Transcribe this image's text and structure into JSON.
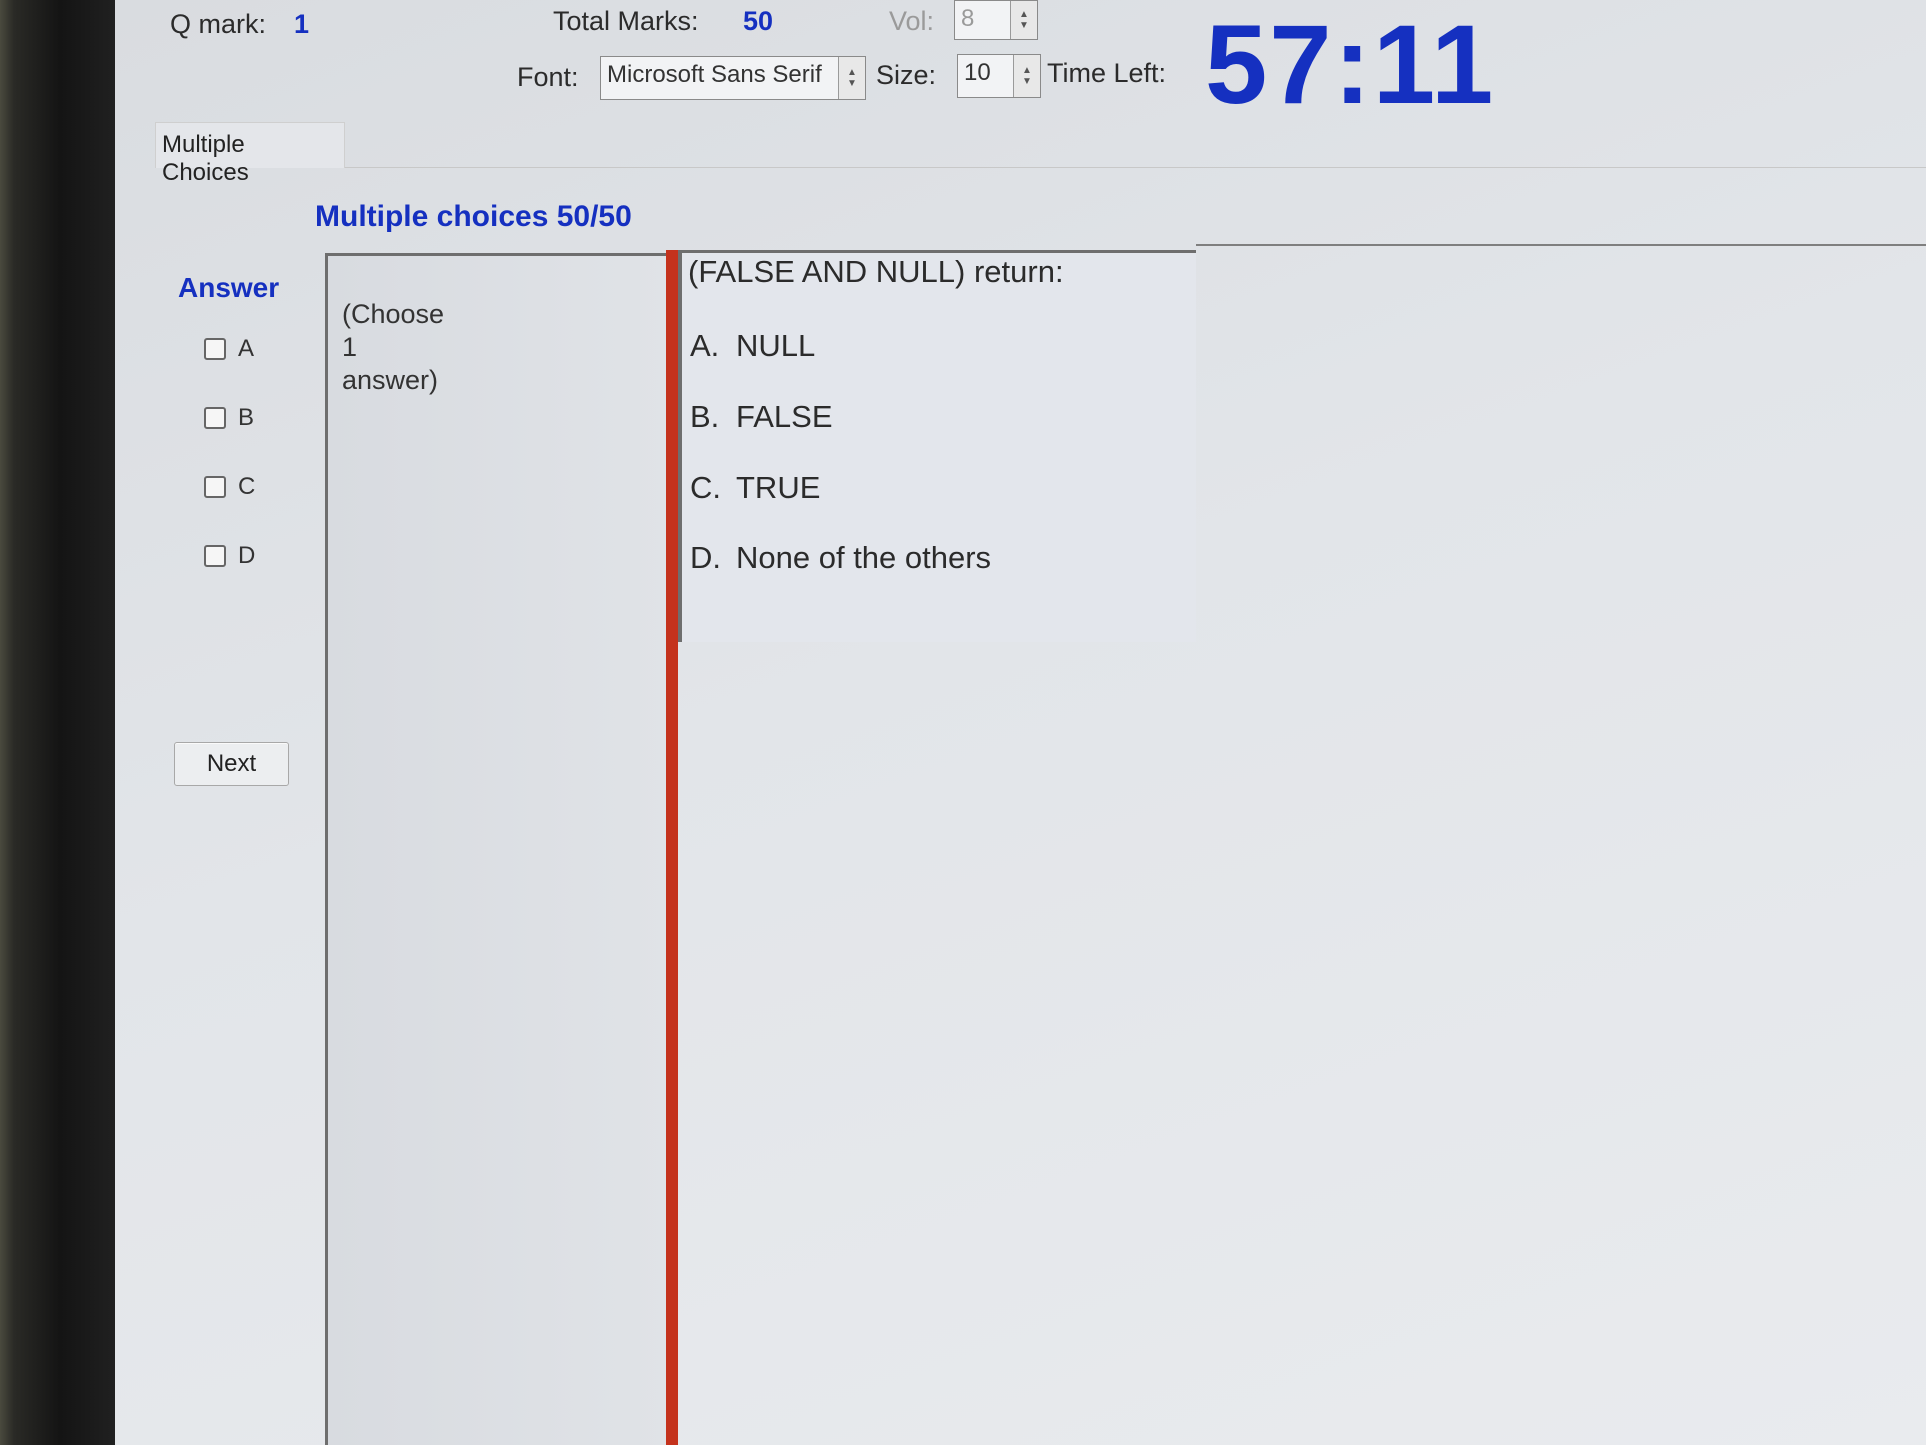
{
  "header": {
    "q_mark_label": "Q mark:",
    "q_mark_value": "1",
    "total_marks_label": "Total Marks:",
    "total_marks_value": "50",
    "vol_label": "Vol:",
    "vol_value": "8",
    "font_label": "Font:",
    "font_value": "Microsoft Sans Serif",
    "size_label": "Size:",
    "size_value": "10",
    "time_left_label": "Time Left:",
    "time_left_value": "57:11"
  },
  "tab": {
    "label": "Multiple Choices"
  },
  "section_title": "Multiple choices 50/50",
  "answer": {
    "title": "Answer",
    "options": [
      {
        "label": "A",
        "checked": false
      },
      {
        "label": "B",
        "checked": false
      },
      {
        "label": "C",
        "checked": false
      },
      {
        "label": "D",
        "checked": false
      }
    ],
    "next_label": "Next"
  },
  "hint": {
    "line1": "(Choose",
    "line2": "1",
    "line3": "answer)"
  },
  "question": {
    "text": "(FALSE AND NULL) return:",
    "choices": [
      {
        "letter": "A.",
        "text": "NULL"
      },
      {
        "letter": "B.",
        "text": "FALSE"
      },
      {
        "letter": "C.",
        "text": "TRUE"
      },
      {
        "letter": "D.",
        "text": "None of the others"
      }
    ]
  },
  "colors": {
    "accent": "#1530c0",
    "divider": "#c4321c"
  }
}
